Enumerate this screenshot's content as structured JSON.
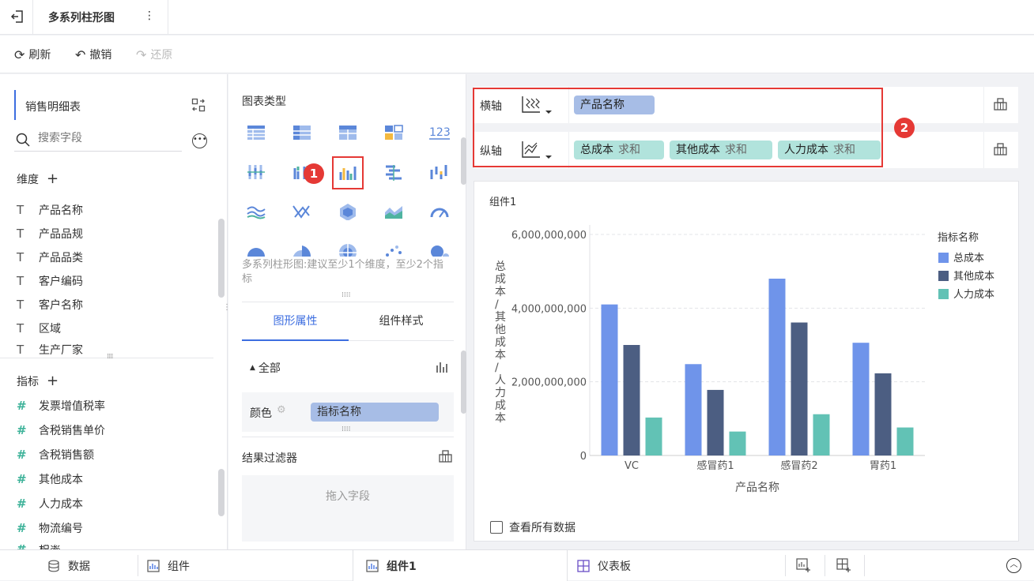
{
  "header": {
    "title": "多系列柱形图",
    "more_icon": "⋮"
  },
  "toolbar": {
    "refresh": "刷新",
    "undo": "撤销",
    "redo": "还原"
  },
  "left": {
    "dataset": "销售明细表",
    "search_placeholder": "搜索字段",
    "dimension_label": "维度",
    "measure_label": "指标",
    "dimensions": [
      "产品名称",
      "产品品规",
      "产品品类",
      "客户编码",
      "客户名称",
      "区域",
      "生产厂家"
    ],
    "measures": [
      "发票增值税率",
      "含税销售单价",
      "含税销售额",
      "其他成本",
      "人力成本",
      "物流编号",
      "税率"
    ]
  },
  "middle": {
    "chart_type_title": "图表类型",
    "hint": "多系列柱形图:建议至少1个维度，至少2个指标",
    "tab_shape": "图形属性",
    "tab_style": "组件样式",
    "all_label": "全部",
    "color_label": "颜色",
    "color_field": "指标名称",
    "filter_label": "结果过滤器",
    "drop_hint": "拖入字段",
    "badge1": "1"
  },
  "axes": {
    "x_label": "横轴",
    "y_label": "纵轴",
    "x_field": "产品名称",
    "y_fields": [
      {
        "name": "总成本",
        "agg": "求和"
      },
      {
        "name": "其他成本",
        "agg": "求和"
      },
      {
        "name": "人力成本",
        "agg": "求和"
      }
    ],
    "badge2": "2"
  },
  "chart": {
    "component_title": "组件1",
    "view_all": "查看所有数据",
    "colors": {
      "总成本": "#6f94ea",
      "其他成本": "#4c5e82",
      "人力成本": "#62c2b5"
    }
  },
  "chart_data": {
    "type": "bar",
    "categories": [
      "VC",
      "感冒药1",
      "感冒药2",
      "胃药1"
    ],
    "series": [
      {
        "name": "总成本",
        "values": [
          4100000000,
          2480000000,
          4800000000,
          3060000000
        ]
      },
      {
        "name": "其他成本",
        "values": [
          3000000000,
          1780000000,
          3610000000,
          2230000000
        ]
      },
      {
        "name": "人力成本",
        "values": [
          1030000000,
          650000000,
          1120000000,
          760000000
        ]
      }
    ],
    "xlabel": "产品名称",
    "ylabel": "总成本/其他成本/人力成本",
    "ylim": [
      0,
      6000000000
    ],
    "yticks": [
      "0",
      "2,000,000,000",
      "4,000,000,000",
      "6,000,000,000"
    ],
    "legend_title": "指标名称",
    "legend_position": "top-right",
    "grid": true
  },
  "bottom": {
    "tab_data": "数据",
    "tab_component": "组件",
    "tab_active": "组件1",
    "tab_dashboard": "仪表板"
  }
}
